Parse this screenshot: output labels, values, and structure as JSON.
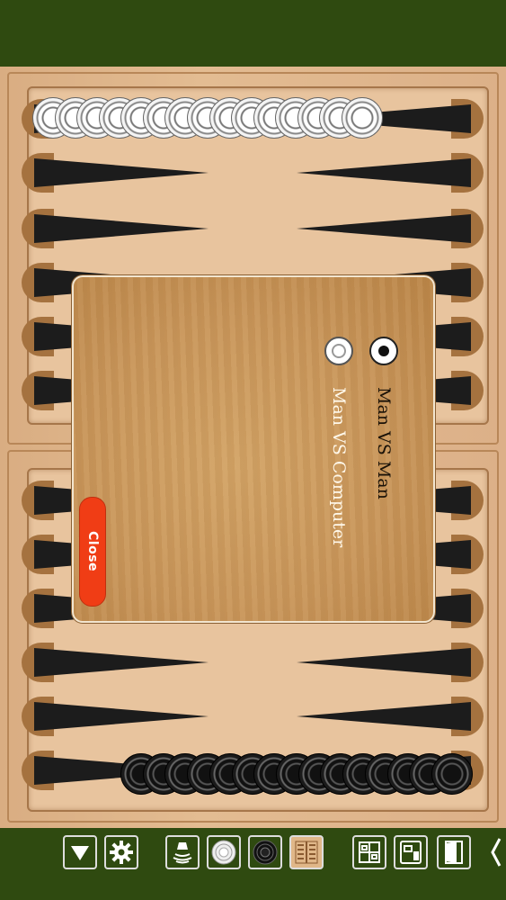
{
  "dialog": {
    "options": [
      {
        "label": "Man VS Man",
        "selected": true
      },
      {
        "label": "Man VS Computer",
        "selected": false
      }
    ],
    "close_label": "Close"
  },
  "colors": {
    "frame_green": "#2f4a10",
    "board_wood": "#e3bc92",
    "point_black": "#1c1c1c",
    "close_red": "#f03d15",
    "white_checker": "#ffffff",
    "black_checker": "#111111"
  },
  "board": {
    "white_checkers_count": 15,
    "black_checkers_count": 15
  },
  "toolbar": {
    "icons": [
      "dropdown-arrow-icon",
      "settings-gear-icon",
      "sound-icon",
      "white-checker-icon",
      "black-checker-icon",
      "board-style-icon",
      "layout-icon",
      "board-view-icon",
      "door-exit-icon",
      "back-chevron-icon"
    ]
  }
}
